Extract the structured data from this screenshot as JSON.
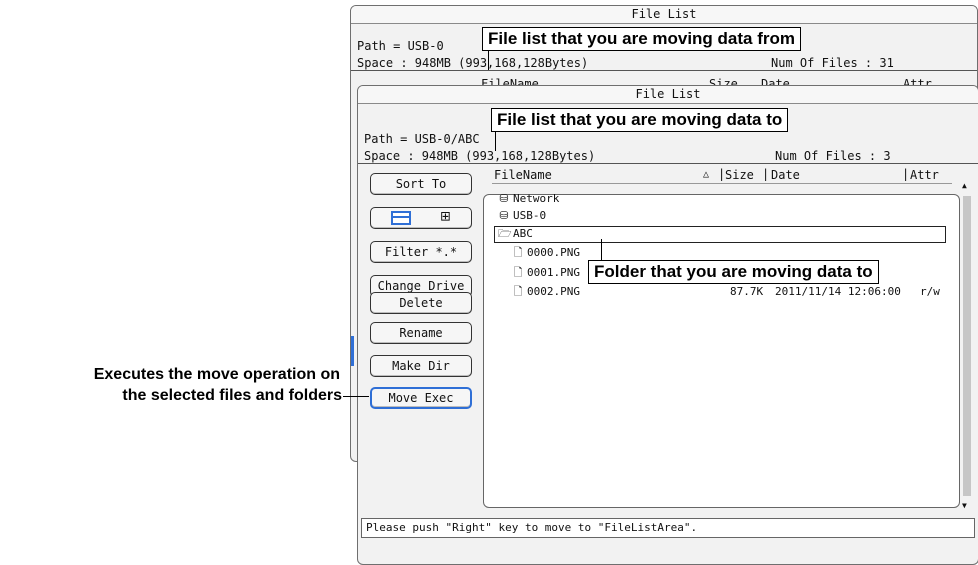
{
  "back_window": {
    "title": "File List",
    "path": "Path = USB-0",
    "space": "Space : 948MB (993,168,128Bytes)",
    "num_files": "Num Of Files : 31",
    "columns": [
      "FileName",
      "Size",
      "Date",
      "Attr"
    ]
  },
  "front_window": {
    "title": "File List",
    "path": "Path = USB-0/ABC",
    "space": "Space : 948MB (993,168,128Bytes)",
    "num_files": "Num Of Files : 3",
    "columns": {
      "name": "FileName",
      "size": "Size",
      "date": "Date",
      "attr": "Attr"
    },
    "sort_indicator": "△",
    "buttons": {
      "sort": "Sort To",
      "filter": "Filter  *.*",
      "change_drive": "Change Drive",
      "delete": "Delete",
      "rename": "Rename",
      "make_dir": "Make Dir",
      "move_exec": "Move Exec"
    },
    "tree": {
      "network": "Network",
      "usb": "USB-0",
      "folder": "ABC"
    },
    "files": [
      {
        "name": "0000.PNG",
        "size": "",
        "date": "",
        "attr": ""
      },
      {
        "name": "0001.PNG",
        "size": "",
        "date": "",
        "attr": ""
      },
      {
        "name": "0002.PNG",
        "size": "87.7K",
        "date": "2011/11/14 12:06:00",
        "attr": "r/w"
      }
    ],
    "status": "Please push \"Right\" key to move to \"FileListArea\"."
  },
  "callouts": {
    "from": "File list that you are moving data from",
    "to": "File list that you are moving data to",
    "folder": "Folder that you are moving data to",
    "exec_line1": "Executes the move operation on",
    "exec_line2": "the selected files and folders"
  },
  "icons": {
    "drive": "drive-icon",
    "folder": "folder-icon",
    "file": "file-icon",
    "list_view": "list-view-icon",
    "grid_view": "grid-view-icon"
  },
  "colors": {
    "accent": "#2f6fd6",
    "background": "#f2f2f2"
  }
}
